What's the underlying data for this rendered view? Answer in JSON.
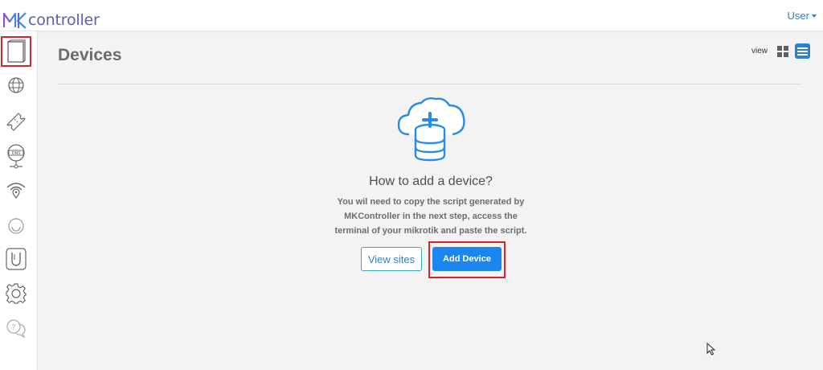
{
  "brand": {
    "logo_mark": "MK",
    "logo_text": "controller",
    "accent": "#5a5fae"
  },
  "header": {
    "user_label": "User"
  },
  "sidebar": {
    "items": [
      {
        "icon": "devices-icon",
        "active": true
      },
      {
        "icon": "globe-icon"
      },
      {
        "icon": "ticket-icon"
      },
      {
        "icon": "dns-icon"
      },
      {
        "icon": "wifi-location-icon"
      },
      {
        "icon": "ring-icon"
      },
      {
        "icon": "ubiquiti-icon"
      },
      {
        "icon": "settings-icon"
      },
      {
        "icon": "help-chat-icon"
      }
    ]
  },
  "page": {
    "title": "Devices",
    "view_label": "view",
    "view_mode": "list"
  },
  "empty_state": {
    "icon": "cloud-database-add-icon",
    "heading": "How to add a device?",
    "description": "You wil need to copy the script generated by MKController in the next step, access the terminal of your mikrotik and paste the script.",
    "view_sites_label": "View sites",
    "add_device_label": "Add Device"
  },
  "colors": {
    "primary": "#1c86f0",
    "highlight": "#e0202a",
    "link": "#2f7fd0"
  }
}
